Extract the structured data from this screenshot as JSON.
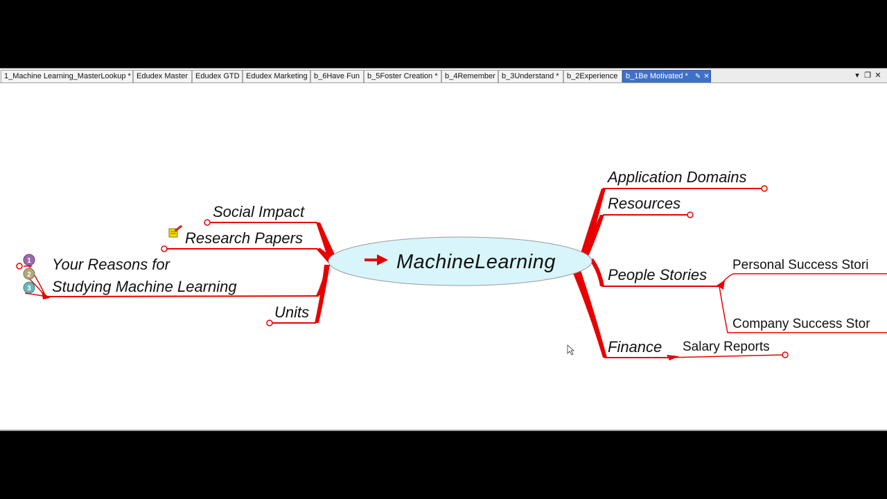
{
  "tabs": [
    {
      "label": "1_Machine Learning_MasterLookup *",
      "active": false
    },
    {
      "label": "Edudex Master",
      "active": false
    },
    {
      "label": "Edudex GTD",
      "active": false
    },
    {
      "label": "Edudex Marketing",
      "active": false
    },
    {
      "label": "b_6Have Fun",
      "active": false
    },
    {
      "label": "b_5Foster Creation *",
      "active": false
    },
    {
      "label": "b_4Remember",
      "active": false
    },
    {
      "label": "b_3Understand *",
      "active": false
    },
    {
      "label": "b_2Experience",
      "active": false
    },
    {
      "label": "b_1Be Motivated *",
      "active": true
    }
  ],
  "window_controls": {
    "menu": "▾",
    "restore": "❐",
    "close": "✕"
  },
  "mindmap": {
    "central": "MachineLearning",
    "left": {
      "social_impact": "Social Impact",
      "research_papers": "Research Papers",
      "reasons_line1": "Your Reasons for",
      "reasons_line2": "Studying  Machine Learning",
      "units": "Units",
      "priority_markers": [
        "1",
        "2",
        "3"
      ]
    },
    "right": {
      "application_domains": "Application Domains",
      "resources": "Resources",
      "people_stories": "People Stories",
      "personal_success": "Personal Success Stori",
      "company_success": "Company Success Stor",
      "finance": "Finance",
      "salary_reports": "Salary Reports"
    }
  },
  "colors": {
    "branch": "#e80000",
    "central_fill": "#d7f5fb",
    "active_tab": "#3f70c9"
  }
}
